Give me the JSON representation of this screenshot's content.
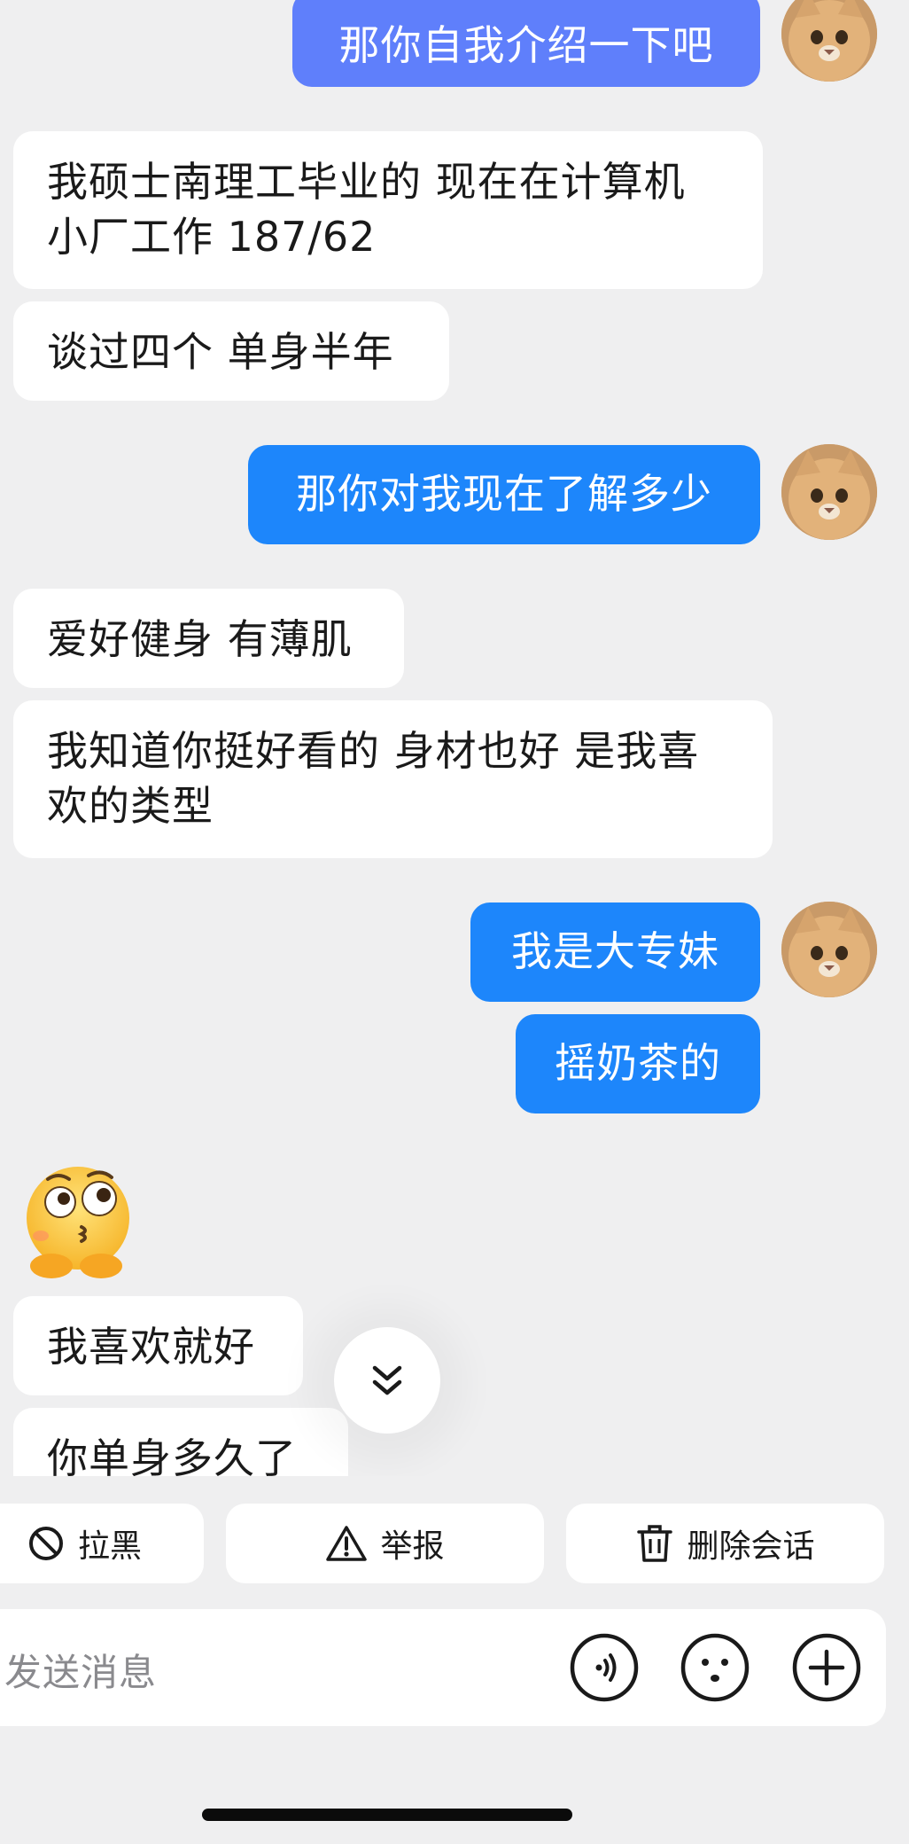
{
  "messages": {
    "m1": "那你自我介绍一下吧",
    "m2_line1": "我硕士南理工毕业的 现在在计算机",
    "m2_line2": "小厂工作 187/62",
    "m3": "谈过四个 单身半年",
    "m4": "那你对我现在了解多少",
    "m5": "爱好健身 有薄肌",
    "m6_line1": "我知道你挺好看的 身材也好 是我喜",
    "m6_line2": "欢的类型",
    "m7": "我是大专妹",
    "m8": "摇奶茶的",
    "m9": "我喜欢就好",
    "m10": "你单身多久了"
  },
  "actions": {
    "block_label": "拉黑",
    "report_label": "举报",
    "delete_label": "删除会话"
  },
  "input": {
    "placeholder": "发送消息"
  },
  "icons": {
    "avatar": "cat-avatar",
    "sticker": "thinking-face-emoji",
    "scroll": "double-chevron-down-icon",
    "block": "block-icon",
    "report": "warning-icon",
    "delete": "trash-icon",
    "voice": "voice-icon",
    "emoji": "emoji-icon",
    "more": "plus-icon"
  },
  "colors": {
    "outgoing_bubble": "#1d86fb",
    "outgoing_bubble_top": "#5f7ffb",
    "incoming_bubble": "#ffffff",
    "background": "#efeff0"
  }
}
